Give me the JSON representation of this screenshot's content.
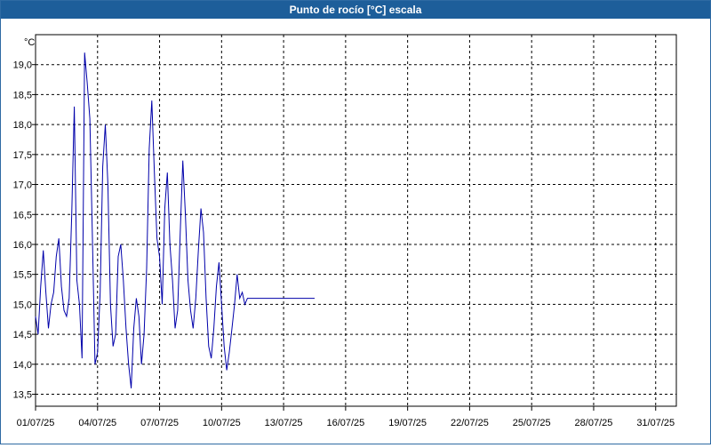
{
  "window": {
    "title": "Punto de rocío [°C] escala"
  },
  "chart_data": {
    "type": "line",
    "title": "Punto de rocío [°C] escala",
    "ylabel": "°C",
    "xlabel": "",
    "ylim": [
      13.3,
      19.5
    ],
    "yticks": [
      13.5,
      14.0,
      14.5,
      15.0,
      15.5,
      16.0,
      16.5,
      17.0,
      17.5,
      18.0,
      18.5,
      19.0
    ],
    "ytick_labels": [
      "13,5",
      "14,0",
      "14,5",
      "15,0",
      "15,5",
      "16,0",
      "16,5",
      "17,0",
      "17,5",
      "18,0",
      "18,5",
      "19,0"
    ],
    "xlim_days": [
      0,
      31
    ],
    "xticks": [
      "01/07/25",
      "04/07/25",
      "07/07/25",
      "10/07/25",
      "13/07/25",
      "16/07/25",
      "19/07/25",
      "22/07/25",
      "25/07/25",
      "28/07/25",
      "31/07/25"
    ],
    "grid": true,
    "line_color": "#0000aa",
    "series": [
      {
        "x": [
          "01/07/25 00:00",
          "01/07/25 03:00",
          "01/07/25 06:00",
          "01/07/25 09:00",
          "01/07/25 12:00",
          "01/07/25 15:00",
          "01/07/25 18:00",
          "01/07/25 21:00",
          "02/07/25 00:00",
          "02/07/25 03:00",
          "02/07/25 06:00",
          "02/07/25 09:00",
          "02/07/25 12:00",
          "02/07/25 15:00",
          "02/07/25 18:00",
          "02/07/25 21:00",
          "03/07/25 00:00",
          "03/07/25 03:00",
          "03/07/25 06:00",
          "03/07/25 09:00",
          "03/07/25 12:00",
          "03/07/25 15:00",
          "03/07/25 18:00",
          "03/07/25 21:00",
          "04/07/25 00:00",
          "04/07/25 03:00",
          "04/07/25 06:00",
          "04/07/25 09:00",
          "04/07/25 12:00",
          "04/07/25 15:00",
          "04/07/25 18:00",
          "04/07/25 21:00",
          "05/07/25 00:00",
          "05/07/25 03:00",
          "05/07/25 06:00",
          "05/07/25 09:00",
          "05/07/25 12:00",
          "05/07/25 15:00",
          "05/07/25 18:00",
          "05/07/25 21:00",
          "06/07/25 00:00",
          "06/07/25 03:00",
          "06/07/25 06:00",
          "06/07/25 09:00",
          "06/07/25 12:00",
          "06/07/25 15:00",
          "06/07/25 18:00",
          "06/07/25 21:00",
          "07/07/25 00:00",
          "07/07/25 03:00",
          "07/07/25 06:00",
          "07/07/25 09:00",
          "07/07/25 12:00",
          "07/07/25 15:00",
          "07/07/25 18:00",
          "07/07/25 21:00",
          "08/07/25 00:00",
          "08/07/25 03:00",
          "08/07/25 06:00",
          "08/07/25 09:00",
          "08/07/25 12:00",
          "08/07/25 15:00",
          "08/07/25 18:00",
          "08/07/25 21:00",
          "09/07/25 00:00",
          "09/07/25 03:00",
          "09/07/25 06:00",
          "09/07/25 09:00",
          "09/07/25 12:00",
          "09/07/25 15:00",
          "09/07/25 18:00",
          "09/07/25 21:00",
          "10/07/25 00:00",
          "10/07/25 03:00",
          "10/07/25 06:00",
          "10/07/25 09:00",
          "10/07/25 12:00",
          "10/07/25 15:00",
          "10/07/25 18:00",
          "10/07/25 21:00",
          "11/07/25 00:00",
          "11/07/25 03:00",
          "11/07/25 06:00",
          "11/07/25 09:00",
          "11/07/25 12:00",
          "11/07/25 15:00",
          "11/07/25 18:00",
          "11/07/25 21:00",
          "12/07/25 00:00",
          "12/07/25 03:00",
          "12/07/25 06:00",
          "12/07/25 09:00",
          "12/07/25 12:00",
          "12/07/25 15:00",
          "12/07/25 18:00",
          "12/07/25 21:00",
          "13/07/25 00:00",
          "13/07/25 03:00",
          "13/07/25 06:00",
          "13/07/25 09:00",
          "13/07/25 12:00",
          "13/07/25 15:00",
          "13/07/25 18:00",
          "13/07/25 21:00",
          "14/07/25 00:00",
          "14/07/25 03:00",
          "14/07/25 06:00",
          "14/07/25 09:00",
          "14/07/25 12:00"
        ],
        "y": [
          14.8,
          14.5,
          15.3,
          15.9,
          15.2,
          14.6,
          15.0,
          15.2,
          15.8,
          16.1,
          15.3,
          14.9,
          14.8,
          15.1,
          16.5,
          18.3,
          15.4,
          15.0,
          14.1,
          19.2,
          18.7,
          18.1,
          16.1,
          14.0,
          14.2,
          15.2,
          17.3,
          18.0,
          17.0,
          15.0,
          14.3,
          14.5,
          15.8,
          16.0,
          15.4,
          14.6,
          14.0,
          13.6,
          14.6,
          15.1,
          14.8,
          14.0,
          14.5,
          15.6,
          17.6,
          18.4,
          17.2,
          16.1,
          15.8,
          15.0,
          16.6,
          17.2,
          16.0,
          15.4,
          14.6,
          14.9,
          16.2,
          17.4,
          16.5,
          15.4,
          14.9,
          14.6,
          15.1,
          15.9,
          16.6,
          16.2,
          15.1,
          14.3,
          14.1,
          14.6,
          15.3,
          15.7,
          15.0,
          14.3,
          13.9,
          14.2,
          14.6,
          15.0,
          15.5,
          15.1,
          15.2,
          15.0,
          15.1,
          15.1,
          15.1,
          15.1,
          15.1,
          15.1,
          15.1,
          15.1,
          15.1,
          15.1,
          15.1,
          15.1,
          15.1,
          15.1,
          15.1,
          15.1,
          15.1,
          15.1,
          15.1,
          15.1,
          15.1,
          15.1,
          15.1,
          15.1,
          15.1,
          15.1,
          15.1
        ]
      }
    ]
  }
}
